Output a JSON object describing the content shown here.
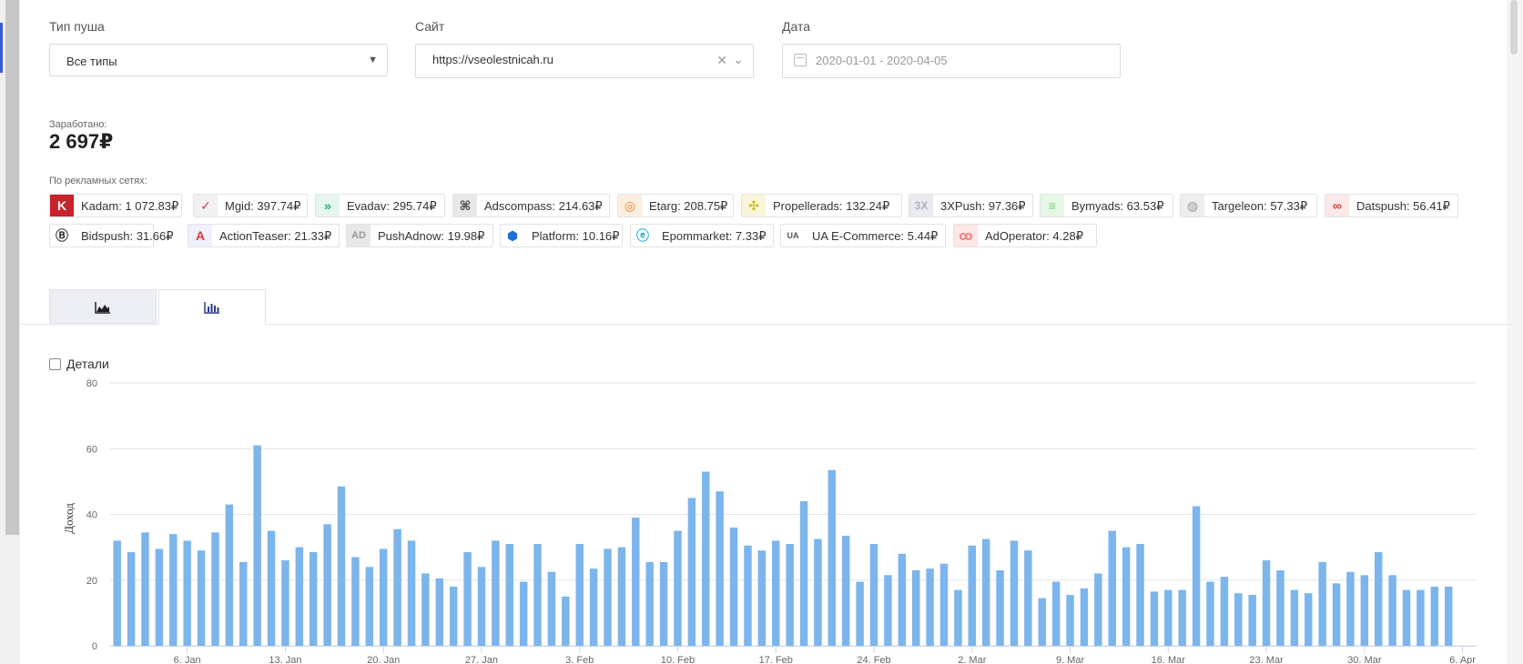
{
  "filters": {
    "type_label": "Тип пуша",
    "type_value": "Все типы",
    "site_label": "Сайт",
    "site_value": "https://vseolestnicah.ru",
    "date_label": "Дата",
    "date_value": "2020-01-01 - 2020-04-05"
  },
  "summary": {
    "earned_label": "Заработано:",
    "earned_value": "2 697₽",
    "networks_label": "По рекламных сетях:"
  },
  "networks": [
    {
      "label": "Kadam: 1 072.83₽",
      "icon": "kadam-icon",
      "color": "#c8232c"
    },
    {
      "label": "Mgid: 397.74₽",
      "icon": "mgid-icon",
      "color": "#e2334a"
    },
    {
      "label": "Evadav: 295.74₽",
      "icon": "evadav-icon",
      "color": "#17b26a"
    },
    {
      "label": "Adscompass: 214.63₽",
      "icon": "adscompass-icon",
      "color": "#444444"
    },
    {
      "label": "Etarg: 208.75₽",
      "icon": "etarg-icon",
      "color": "#f07a1a"
    },
    {
      "label": "Propellerads: 132.24₽",
      "icon": "propellerads-icon",
      "color": "#c9b800"
    },
    {
      "label": "3XPush: 97.36₽",
      "icon": "3xpush-icon",
      "color": "#aab0c0"
    },
    {
      "label": "Bymyads: 63.53₽",
      "icon": "bymyads-icon",
      "color": "#7bd27b"
    },
    {
      "label": "Targeleon: 57.33₽",
      "icon": "targeleon-icon",
      "color": "#999999"
    },
    {
      "label": "Datspush: 56.41₽",
      "icon": "datspush-icon",
      "color": "#e23a3a"
    },
    {
      "label": "Bidspush: 31.66₽",
      "icon": "bidspush-icon",
      "color": "#333333"
    },
    {
      "label": "ActionTeaser: 21.33₽",
      "icon": "actionteaser-icon",
      "color": "#e23a3a"
    },
    {
      "label": "PushAdnow: 19.98₽",
      "icon": "pushadnow-icon",
      "color": "#999999"
    },
    {
      "label": "Platform: 10.16₽",
      "icon": "platform-icon",
      "color": "#1e6fd9"
    },
    {
      "label": "Epommarket: 7.33₽",
      "icon": "epommarket-icon",
      "color": "#2ab0d8"
    },
    {
      "label": "UA E-Commerce: 5.44₽",
      "icon": "ua-ecommerce-icon",
      "color": "#555555"
    },
    {
      "label": "AdOperator: 4.28₽",
      "icon": "adoperator-icon",
      "color": "#f08a8a"
    }
  ],
  "tabs": [
    {
      "icon": "area-chart-icon"
    },
    {
      "icon": "bar-chart-icon"
    }
  ],
  "details_label": "Детали",
  "chart_data": {
    "type": "bar",
    "ylabel": "Доход",
    "ylim": [
      0,
      80
    ],
    "yticks": [
      0,
      20,
      40,
      60,
      80
    ],
    "grid": true,
    "bar_color": "#7cb5ec",
    "x_start": "2020-01-01",
    "x_end": "2020-04-05",
    "x_axis_max": "2020-04-07",
    "xtick_labels": [
      {
        "date": "2020-01-06",
        "label": "6. Jan"
      },
      {
        "date": "2020-01-13",
        "label": "13. Jan"
      },
      {
        "date": "2020-01-20",
        "label": "20. Jan"
      },
      {
        "date": "2020-01-27",
        "label": "27. Jan"
      },
      {
        "date": "2020-02-03",
        "label": "3. Feb"
      },
      {
        "date": "2020-02-10",
        "label": "10. Feb"
      },
      {
        "date": "2020-02-17",
        "label": "17. Feb"
      },
      {
        "date": "2020-02-24",
        "label": "24. Feb"
      },
      {
        "date": "2020-03-02",
        "label": "2. Mar"
      },
      {
        "date": "2020-03-09",
        "label": "9. Mar"
      },
      {
        "date": "2020-03-16",
        "label": "16. Mar"
      },
      {
        "date": "2020-03-23",
        "label": "23. Mar"
      },
      {
        "date": "2020-03-30",
        "label": "30. Mar"
      },
      {
        "date": "2020-04-06",
        "label": "6. Apr"
      }
    ],
    "values": [
      32,
      28.5,
      34.5,
      29.5,
      34,
      32,
      29,
      34.5,
      43,
      25.5,
      61,
      35,
      26,
      30,
      28.5,
      37,
      48.5,
      27,
      24,
      29.5,
      35.5,
      32,
      22,
      20.5,
      18,
      28.5,
      24,
      32,
      31,
      19.5,
      31,
      22.5,
      15,
      31,
      23.5,
      29.5,
      30,
      39,
      25.5,
      25.5,
      35,
      45,
      53,
      47,
      36,
      30.5,
      29,
      32,
      31,
      44,
      32.5,
      53.5,
      33.5,
      19.5,
      31,
      21.5,
      28,
      23,
      23.5,
      25,
      17,
      30.5,
      32.5,
      23,
      32,
      29,
      14.5,
      19.5,
      15.5,
      17.5,
      22,
      35,
      30,
      31,
      16.5,
      17,
      17,
      42.5,
      19.5,
      21,
      16,
      15.5,
      26,
      23,
      17,
      16,
      25.5,
      19,
      22.5,
      21.5,
      28.5,
      21.5,
      17,
      17,
      18,
      18
    ]
  }
}
